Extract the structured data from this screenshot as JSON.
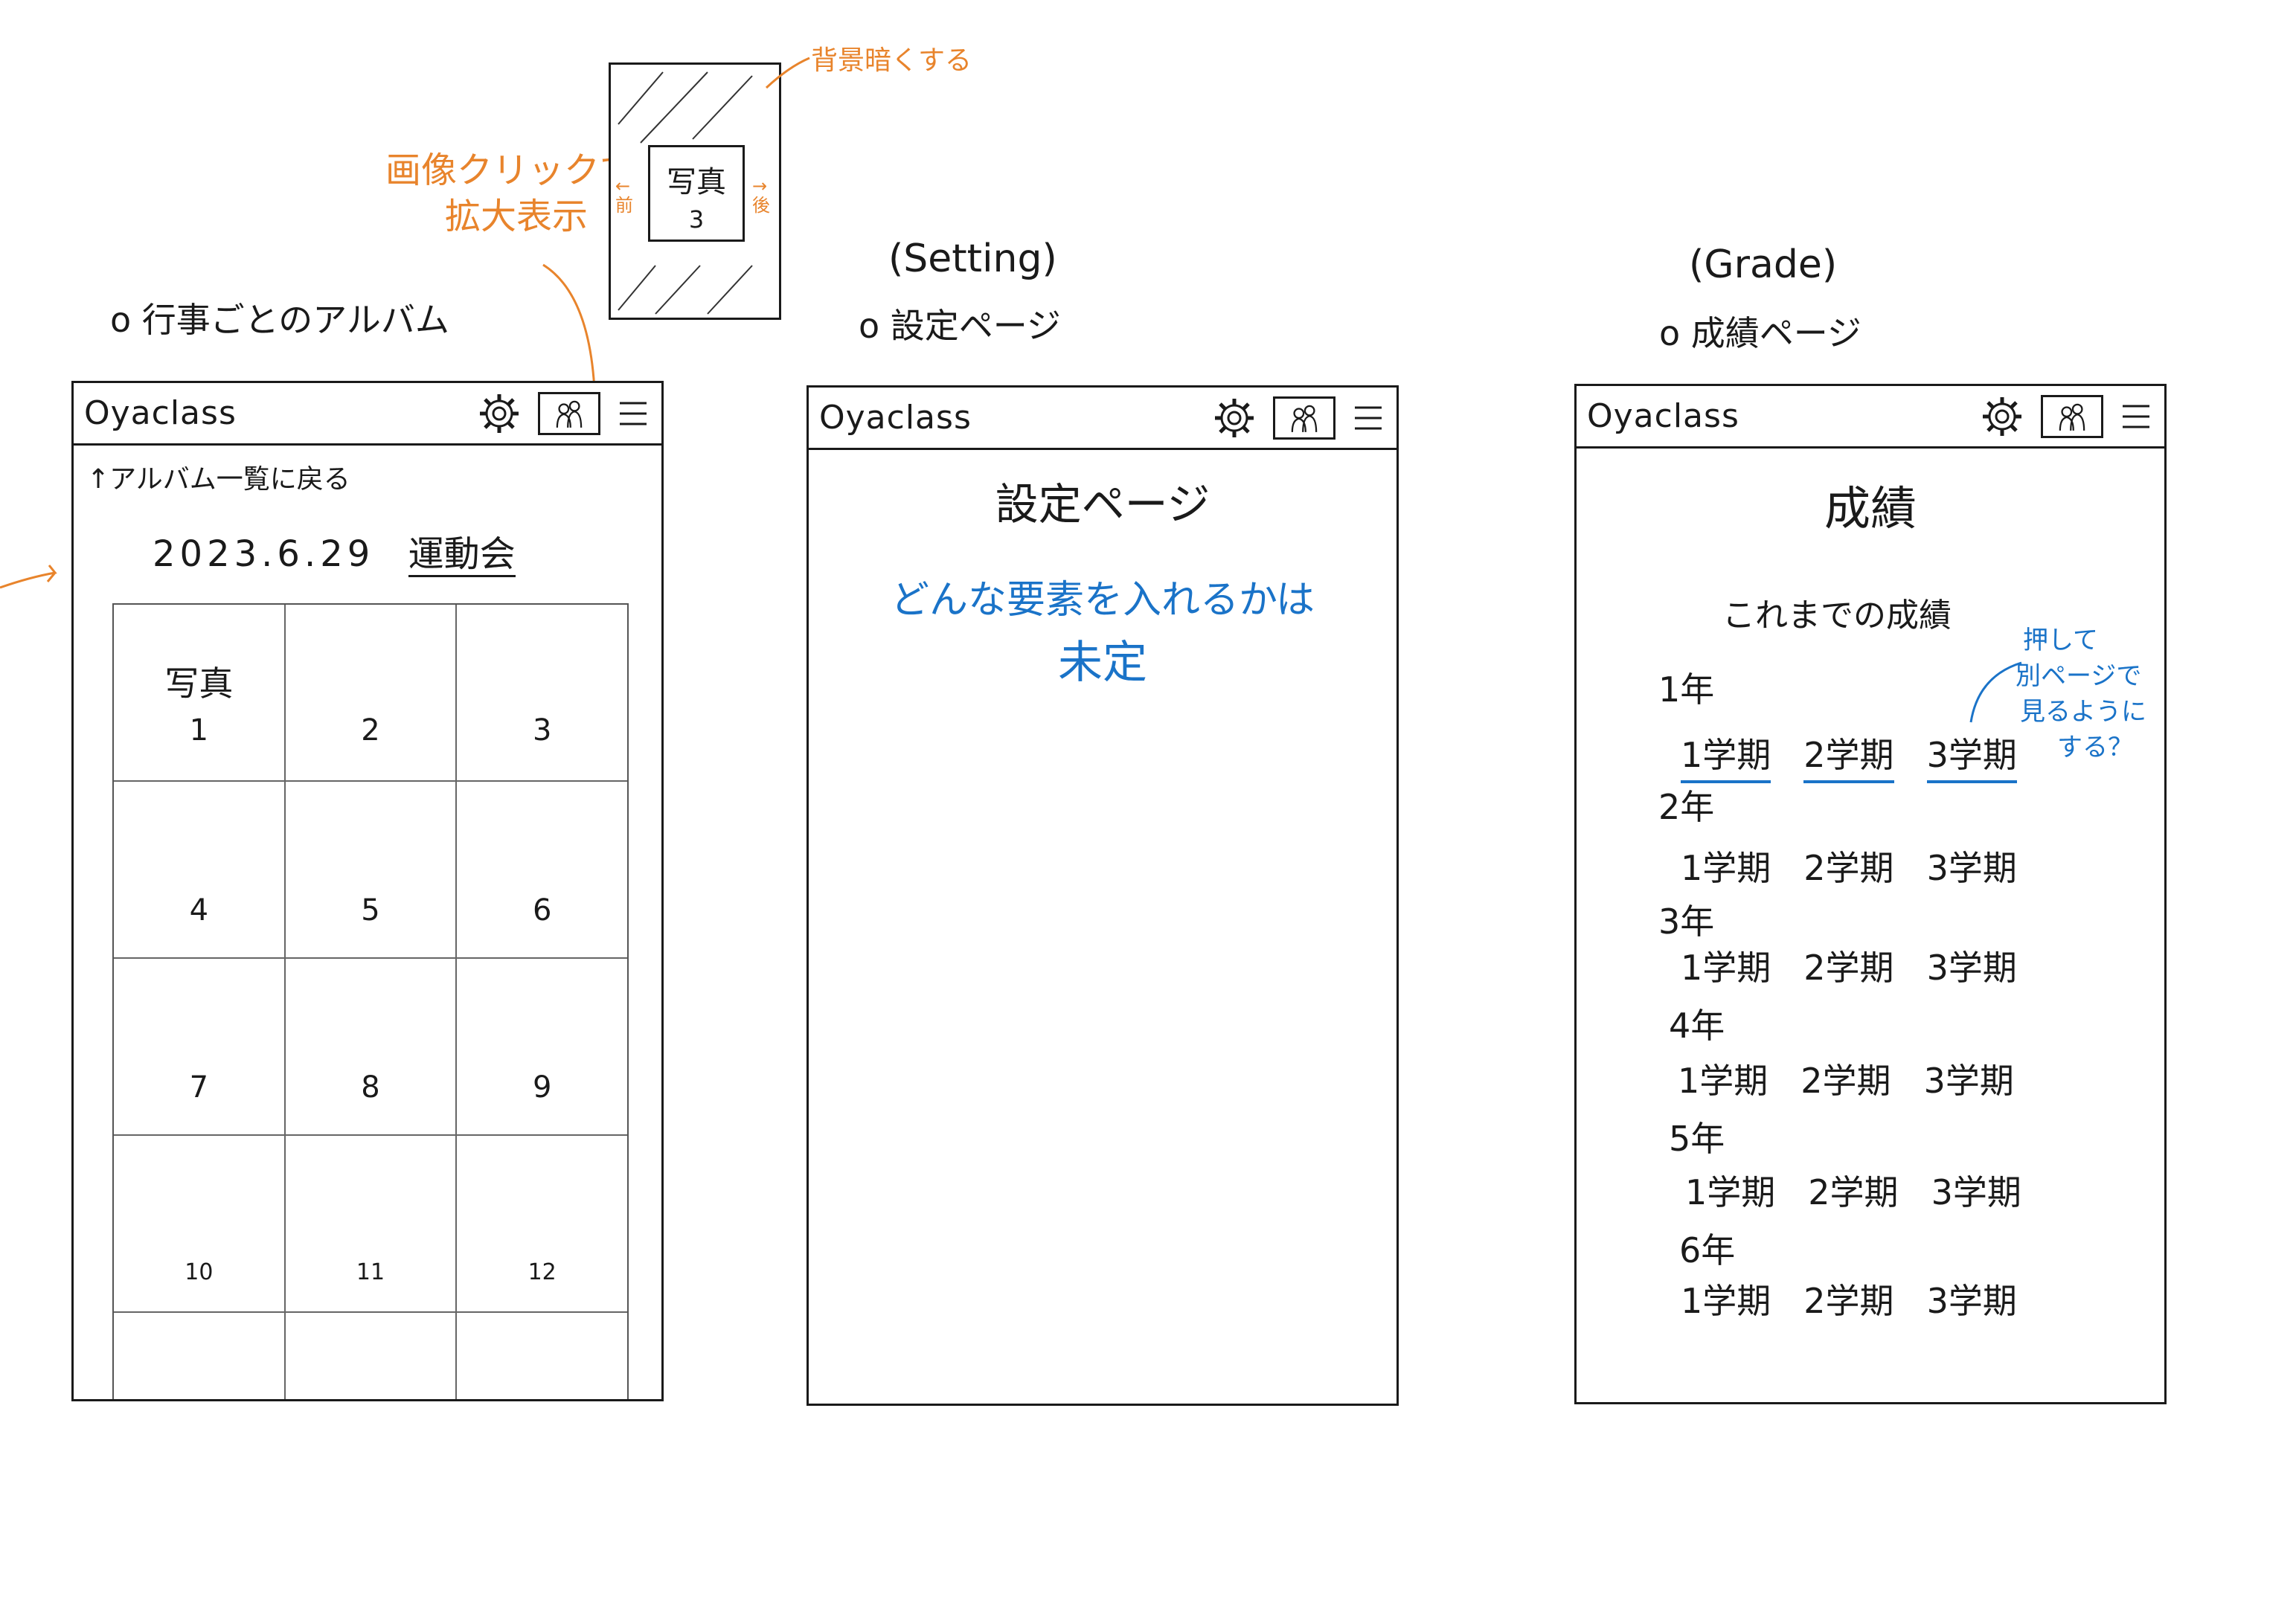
{
  "annotations": {
    "album_click": [
      "画像クリックで",
      "拡大表示"
    ],
    "darken_bg": "背景暗くする",
    "prev": "←前",
    "next": "→後",
    "grade_note": [
      "押して",
      "別ページで",
      "見るように",
      "する？"
    ]
  },
  "popup": {
    "photo_label": "写真",
    "photo_number": "3"
  },
  "album_page": {
    "section_label": "o 行事ごとのアルバム",
    "app_name": "Oyaclass",
    "back_link": "↑アルバム一覧に戻る",
    "event_date": "2023.6.29",
    "event_name": "運動会",
    "first_photo_label": "写真",
    "photos": [
      "1",
      "2",
      "3",
      "4",
      "5",
      "6",
      "7",
      "8",
      "9",
      "10",
      "11",
      "12"
    ]
  },
  "settings_page": {
    "section_en": "(Setting)",
    "section_label": "o 設定ページ",
    "app_name": "Oyaclass",
    "title": "設定ページ",
    "note_line1": "どんな要素を入れるかは",
    "note_line2": "未定"
  },
  "grade_page": {
    "section_en": "(Grade)",
    "section_label": "o 成績ページ",
    "app_name": "Oyaclass",
    "title": "成績",
    "subtitle": "これまでの成績",
    "years": [
      {
        "label": "1年",
        "terms": [
          "1学期",
          "2学期",
          "3学期"
        ]
      },
      {
        "label": "2年",
        "terms": [
          "1学期",
          "2学期",
          "3学期"
        ]
      },
      {
        "label": "3年",
        "terms": [
          "1学期",
          "2学期",
          "3学期"
        ]
      },
      {
        "label": "4年",
        "terms": [
          "1学期",
          "2学期",
          "3学期"
        ]
      },
      {
        "label": "5年",
        "terms": [
          "1学期",
          "2学期",
          "3学期"
        ]
      },
      {
        "label": "6年",
        "terms": [
          "1学期",
          "2学期",
          "3学期"
        ]
      }
    ]
  },
  "colors": {
    "ink": "#1a1a1a",
    "annotation_orange": "#e8842c",
    "annotation_blue": "#1a73c8"
  },
  "icons": [
    "gear-icon",
    "photo-family-icon",
    "hamburger-icon",
    "arrow-icon",
    "cursor-icon"
  ]
}
